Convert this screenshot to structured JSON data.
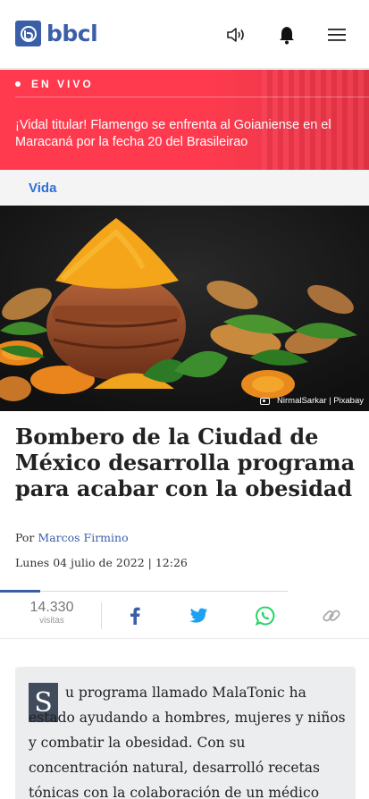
{
  "header": {
    "logo_text": "bbcl",
    "icons": [
      "speaker-icon",
      "bell-icon",
      "menu-icon"
    ]
  },
  "live": {
    "label": "EN VIVO",
    "headline": "¡Vidal titular! Flamengo se enfrenta al Goianiense en el Maracaná por la fecha 20 del Brasileirao"
  },
  "section": {
    "label": "Vida"
  },
  "hero": {
    "credit": "NirmalSarkar | Pixabay"
  },
  "article": {
    "title": "Bombero de la Ciudad de México desarrolla programa para acabar con la obesidad",
    "by_prefix": "Por",
    "author": "Marcos Firmino",
    "date": "Lunes 04 julio de 2022 | 12:26",
    "views": "14.330",
    "views_label": "visitas",
    "dropcap": "S",
    "body": "u programa llamado MalaTonic ha estado ayudando a hombres, mujeres y niños y combatir la obesidad. Con su concentración natural, desarrolló recetas tónicas con la colaboración de un médico"
  },
  "colors": {
    "brand": "#3b5ea8",
    "live_bg": "#ff3a4e",
    "section_link": "#2f6fd6",
    "facebook": "#3b5ea8",
    "twitter": "#1da1f2",
    "whatsapp": "#25d366"
  }
}
